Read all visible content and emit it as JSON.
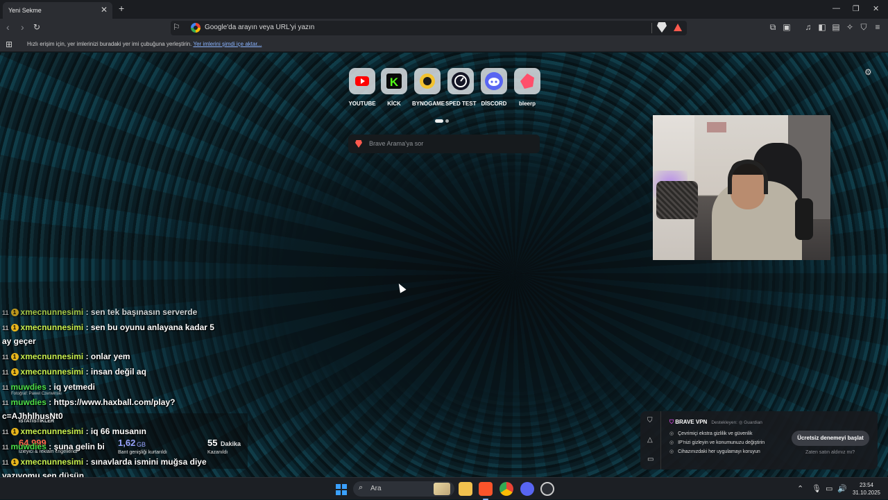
{
  "browser": {
    "tab_title": "Yeni Sekme",
    "tab_close": "✕",
    "new_tab": "+",
    "window_controls": [
      "—",
      "❐",
      "✕"
    ],
    "url_placeholder": "Google'da arayın veya URL'yi yazın",
    "bookmarks_bar_text": "Hızlı erişim için, yer imlerinizi buradaki yer imi çubuğuna yerleştirin.",
    "bookmarks_bar_link": "Yer imlerini şimdi içe aktar..."
  },
  "newtab": {
    "tiles": [
      {
        "label": "YOUTUBE",
        "icon": "youtube-icon",
        "color": "#ff0000"
      },
      {
        "label": "KİCK",
        "icon": "kick-icon",
        "color": "#53fc18"
      },
      {
        "label": "BYNOGAME",
        "icon": "bynogame-icon",
        "color": "#f2c230"
      },
      {
        "label": "SPED TEST",
        "icon": "speedtest-icon",
        "color": "#141526"
      },
      {
        "label": "DİSCORD",
        "icon": "discord-icon",
        "color": "#5865f2"
      },
      {
        "label": "bleerp",
        "icon": "bleerp-icon",
        "color": "#ff4f6b"
      }
    ],
    "search_placeholder": "Brave Arama'ya sor",
    "photo_credit": "Fotoğraf: Pawel Czerwinski"
  },
  "chat": [
    {
      "user": "xmecnunnesimi",
      "text": ": sen tek başınasın serverde",
      "color": "yellow",
      "badge": true
    },
    {
      "user": "xmecnunnesimi",
      "text": ": sen bu oyunu anlayana kadar 5",
      "color": "yellow",
      "badge": true
    },
    {
      "user": "",
      "text": "ay geçer",
      "color": "",
      "badge": false
    },
    {
      "user": "xmecnunnesimi",
      "text": ": onlar yem",
      "color": "yellow",
      "badge": true
    },
    {
      "user": "xmecnunnesimi",
      "text": ": insan değil aq",
      "color": "yellow",
      "badge": true
    },
    {
      "user": "muwdies",
      "text": ": iq yetmedi",
      "color": "green",
      "badge": false
    },
    {
      "user": "muwdies",
      "text": ": https://www.haxball.com/play?",
      "color": "green",
      "badge": false
    },
    {
      "user": "",
      "text": "c=AJhhlhusNt0",
      "color": "",
      "badge": false
    },
    {
      "user": "xmecnunnesimi",
      "text": ": iq 66 musanın",
      "color": "yellow",
      "badge": true
    },
    {
      "user": "muwdies",
      "text": ": şuna gelin bi",
      "color": "green",
      "badge": false
    },
    {
      "user": "xmecnunnesimi",
      "text": ": sınavlarda ismini muğsa diye",
      "color": "yellow",
      "badge": true
    },
    {
      "user": "",
      "text": "yazıyomu sen düşün",
      "color": "",
      "badge": false
    }
  ],
  "stats": {
    "title": "İSTATİSTİKLER",
    "blocked_value": "64.999",
    "blocked_label": "İzleyici & reklam engellendi",
    "bandwidth_value": "1,62",
    "bandwidth_unit": "GB",
    "bandwidth_label": "Bant genişliği kurtarıldı",
    "time_value": "55",
    "time_unit": "Dakika",
    "time_label": "Kazanıldı"
  },
  "vpn": {
    "title": "BRAVE VPN",
    "supported_by": "Destekleyen: ◎ Guardian",
    "features": [
      "Çevrimiçi ekstra gizlilik ve güvenlik",
      "IP'nizi gizleyin ve konumunuzu değiştirin",
      "Cihazınızdaki her uygulamayı koruyun"
    ],
    "cta": "Ücretsiz denemeyi başlat",
    "already": "Zaten satın aldınız mı?"
  },
  "taskbar": {
    "search_placeholder": "Ara",
    "time": "23:54",
    "date": "31.10.2025"
  }
}
